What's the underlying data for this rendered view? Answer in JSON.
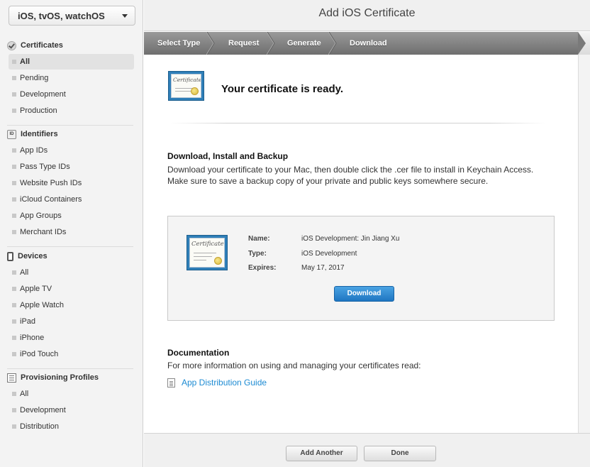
{
  "platform": {
    "selected": "iOS, tvOS, watchOS"
  },
  "sidebar": {
    "groups": [
      {
        "title": "Certificates",
        "items": [
          "All",
          "Pending",
          "Development",
          "Production"
        ]
      },
      {
        "title": "Identifiers",
        "items": [
          "App IDs",
          "Pass Type IDs",
          "Website Push IDs",
          "iCloud Containers",
          "App Groups",
          "Merchant IDs"
        ]
      },
      {
        "title": "Devices",
        "items": [
          "All",
          "Apple TV",
          "Apple Watch",
          "iPad",
          "iPhone",
          "iPod Touch"
        ]
      },
      {
        "title": "Provisioning Profiles",
        "items": [
          "All",
          "Development",
          "Distribution"
        ]
      }
    ],
    "id_icon_text": "ID"
  },
  "header": {
    "title": "Add iOS Certificate"
  },
  "steps": [
    "Select Type",
    "Request",
    "Generate",
    "Download"
  ],
  "colors": {
    "link": "#1d8bd3",
    "primary_button": "#1f76c2",
    "steps_bar": "#7d7d7d"
  },
  "main": {
    "ready_text": "Your certificate is ready.",
    "download_section": {
      "title": "Download, Install and Backup",
      "text": "Download your certificate to your Mac, then double click the .cer file to install in Keychain Access. Make sure to save a backup copy of your private and public keys somewhere secure."
    },
    "certificate": {
      "name_label": "Name:",
      "name_value": "iOS Development: Jin Jiang Xu",
      "type_label": "Type:",
      "type_value": "iOS Development",
      "expires_label": "Expires:",
      "expires_value": "May 17, 2017",
      "download_label": "Download"
    },
    "documentation": {
      "title": "Documentation",
      "text": "For more information on using and managing your certificates read:",
      "link": "App Distribution Guide"
    }
  },
  "footer": {
    "add_another_label": "Add Another",
    "done_label": "Done"
  }
}
